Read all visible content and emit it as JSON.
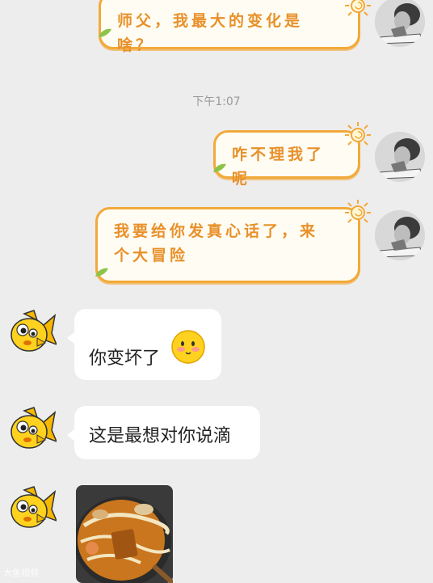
{
  "chat": {
    "timestamp": "下午1:07",
    "messages": [
      {
        "side": "right",
        "text": "师父，我最大的变化是啥？"
      },
      {
        "side": "right",
        "text": "咋不理我了呢"
      },
      {
        "side": "right",
        "text": "我要给你发真心话了，来个大冒险"
      },
      {
        "side": "left",
        "text": "你变坏了"
      },
      {
        "side": "left",
        "text": "这是最想对你说滴"
      },
      {
        "side": "left",
        "type": "image",
        "description": "photo"
      }
    ]
  },
  "watermark": "大鱼视频",
  "colors": {
    "background": "#ededed",
    "right_bubble_border": "#f2a93a",
    "right_bubble_text": "#e8902a",
    "left_bubble": "#ffffff"
  },
  "icons": [
    "sun-icon",
    "leaf-icon",
    "blush-emoji-icon",
    "fish-avatar-icon",
    "user-avatar"
  ]
}
